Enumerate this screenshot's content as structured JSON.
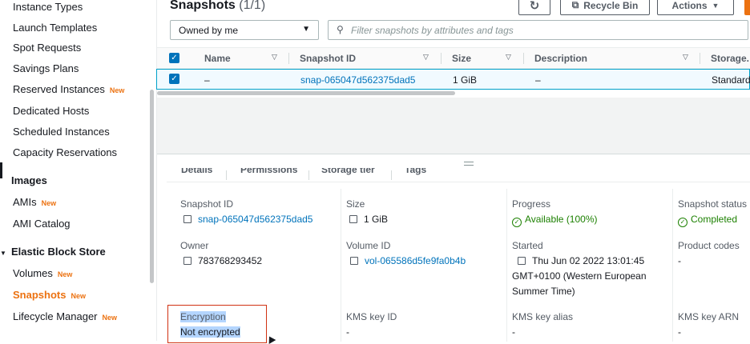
{
  "sidebar": {
    "items": [
      {
        "label": "Instance Types"
      },
      {
        "label": "Launch Templates"
      },
      {
        "label": "Spot Requests"
      },
      {
        "label": "Savings Plans"
      },
      {
        "label": "Reserved Instances",
        "badge": "New"
      },
      {
        "label": "Dedicated Hosts"
      },
      {
        "label": "Scheduled Instances"
      },
      {
        "label": "Capacity Reservations"
      }
    ],
    "images_section": "Images",
    "images_items": [
      {
        "label": "AMIs",
        "badge": "New"
      },
      {
        "label": "AMI Catalog"
      }
    ],
    "ebs_section": "Elastic Block Store",
    "ebs_items": [
      {
        "label": "Volumes",
        "badge": "New"
      },
      {
        "label": "Snapshots",
        "badge": "New"
      },
      {
        "label": "Lifecycle Manager",
        "badge": "New"
      }
    ]
  },
  "header": {
    "title": "Snapshots",
    "count": "(1/1)",
    "recycle_bin_label": "Recycle Bin",
    "actions_label": "Actions"
  },
  "filters": {
    "owner_selected": "Owned by me",
    "search_placeholder": "Filter snapshots by attributes and tags"
  },
  "table": {
    "columns": [
      "Name",
      "Snapshot ID",
      "Size",
      "Description",
      "Storage."
    ],
    "rows": [
      {
        "name": "–",
        "snapshot_id": "snap-065047d562375dad5",
        "size": "1 GiB",
        "description": "–",
        "storage": "Standard"
      }
    ]
  },
  "details": {
    "tabs": [
      "Details",
      "Permissions",
      "Storage tier",
      "Tags"
    ],
    "snapshot_id_label": "Snapshot ID",
    "snapshot_id": "snap-065047d562375dad5",
    "size_label": "Size",
    "size": "1 GiB",
    "progress_label": "Progress",
    "progress": "Available (100%)",
    "status_label": "Snapshot status",
    "status": "Completed",
    "owner_label": "Owner",
    "owner": "783768293452",
    "volume_id_label": "Volume ID",
    "volume_id": "vol-065586d5fe9fa0b4b",
    "started_label": "Started",
    "started_line1": "Thu Jun 02 2022 13:01:45",
    "started_line2": "GMT+0100 (Western European",
    "started_line3": "Summer Time)",
    "product_codes_label": "Product codes",
    "product_codes": "-",
    "encryption_label": "Encryption",
    "encryption": "Not encrypted",
    "kms_key_id_label": "KMS key ID",
    "kms_key_id": "-",
    "kms_key_alias_label": "KMS key alias",
    "kms_key_alias": "-",
    "kms_key_arn_label": "KMS key ARN",
    "kms_key_arn": "-"
  },
  "colors": {
    "accent": "#ec7211",
    "link": "#0073bb",
    "success": "#1d8102",
    "highlight_border": "#d13212"
  }
}
